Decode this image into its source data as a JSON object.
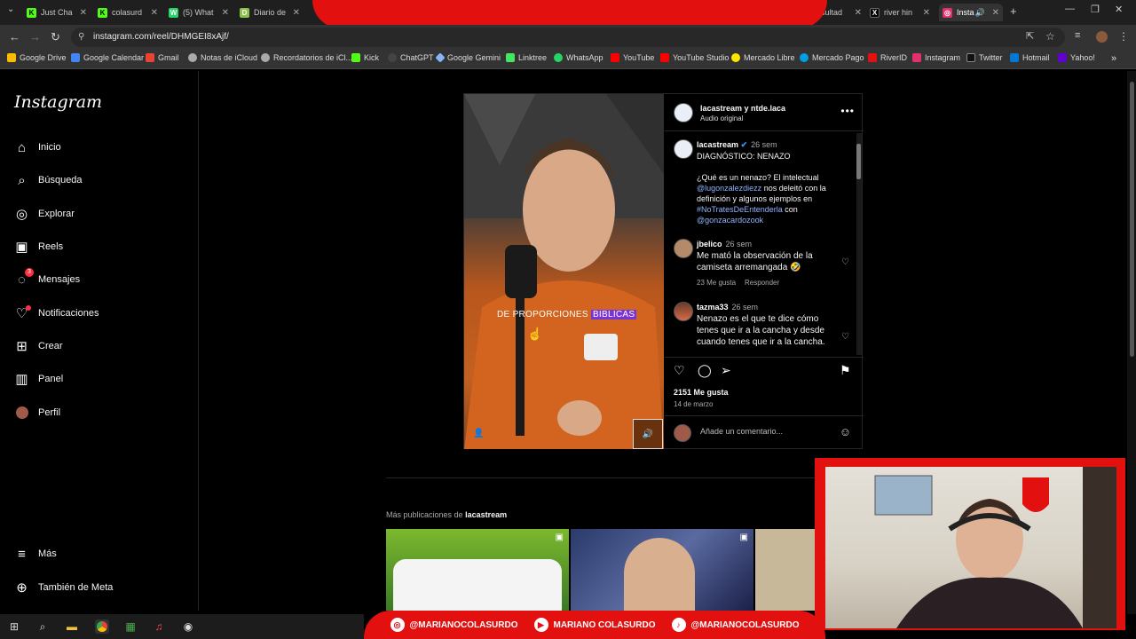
{
  "browser": {
    "tabs": [
      {
        "label": "Just Cha",
        "fav_color": "#53fc18",
        "fav_letter": "K"
      },
      {
        "label": "colasurd",
        "fav_color": "#53fc18",
        "fav_letter": "K"
      },
      {
        "label": "(5) What",
        "fav_color": "#25d366",
        "fav_letter": "W"
      },
      {
        "label": "Diario de",
        "fav_color": "#8bc34a",
        "fav_letter": "D"
      },
      {
        "label": "sultad",
        "fav_color": "#555555",
        "fav_letter": ""
      },
      {
        "label": "river hin",
        "fav_color": "#000000",
        "fav_letter": "X"
      },
      {
        "label": "Insta",
        "fav_color": "#e1306c",
        "fav_letter": "◎"
      }
    ],
    "url": "instagram.com/reel/DHMGEI8xAjf/",
    "bookmarks": [
      {
        "label": "Google Drive",
        "color": "#fbbc04"
      },
      {
        "label": "Google Calendar",
        "color": "#4285f4"
      },
      {
        "label": "Gmail",
        "color": "#ea4335"
      },
      {
        "label": "Notas de iCloud",
        "color": "#aaaaaa"
      },
      {
        "label": "Recordatorios de iCl...",
        "color": "#aaaaaa"
      },
      {
        "label": "Kick",
        "color": "#53fc18"
      },
      {
        "label": "ChatGPT",
        "color": "#444444"
      },
      {
        "label": "Google Gemini",
        "color": "#8ab4f8"
      },
      {
        "label": "Linktree",
        "color": "#43e660"
      },
      {
        "label": "WhatsApp",
        "color": "#25d366"
      },
      {
        "label": "YouTube",
        "color": "#ff0000"
      },
      {
        "label": "YouTube Studio",
        "color": "#ff0000"
      },
      {
        "label": "Mercado Libre",
        "color": "#ffe600"
      },
      {
        "label": "Mercado Pago",
        "color": "#009ee3"
      },
      {
        "label": "RiverID",
        "color": "#e31010"
      },
      {
        "label": "Instagram",
        "color": "#e1306c"
      },
      {
        "label": "Twitter",
        "color": "#111111"
      },
      {
        "label": "Hotmail",
        "color": "#0078d4"
      },
      {
        "label": "Yahoo!",
        "color": "#6001d2"
      }
    ]
  },
  "sidebar": {
    "logo": "Instagram",
    "items": [
      {
        "label": "Inicio",
        "icon": "⌂",
        "name": "home"
      },
      {
        "label": "Búsqueda",
        "icon": "⌕",
        "name": "search"
      },
      {
        "label": "Explorar",
        "icon": "◎",
        "name": "explore"
      },
      {
        "label": "Reels",
        "icon": "▣",
        "name": "reels"
      },
      {
        "label": "Mensajes",
        "icon": "◌",
        "name": "messages"
      },
      {
        "label": "Notificaciones",
        "icon": "♡",
        "name": "notifications"
      },
      {
        "label": "Crear",
        "icon": "⊞",
        "name": "create"
      },
      {
        "label": "Panel",
        "icon": "▥",
        "name": "dashboard"
      },
      {
        "label": "Perfil",
        "icon": "●",
        "name": "profile"
      }
    ],
    "messages_badge": "3",
    "more": {
      "label": "Más",
      "icon": "≡"
    },
    "meta": {
      "label": "También de Meta",
      "icon": "⊕"
    }
  },
  "post": {
    "header_name": "lacastream y ntde.laca",
    "header_audio": "Audio original",
    "caption_overlay_a": "DE PROPORCIONES ",
    "caption_overlay_b": "BIBLICAS",
    "caption": {
      "user": "lacastream",
      "time": "26 sem",
      "title": "DIAGNÓSTICO: NENAZO",
      "line1": "¿Qué es un nenazo? El intelectual",
      "mention1": "@lugonzalezdiezz",
      "line2": " nos deleitó con la definición y algunos ejemplos en",
      "hashtag": "#NoTratesDeEntenderla",
      "line3": " con",
      "mention2": "@gonzacardozook"
    },
    "comments": [
      {
        "user": "jbelico",
        "time": "26 sem",
        "text": "Me mató la observación de la camiseta arremangada 🤣",
        "likes": "23 Me gusta",
        "reply": "Responder"
      },
      {
        "user": "tazma33",
        "time": "26 sem",
        "text": "Nenazo es el que te dice cómo tenes que ir a la cancha y desde cuando tenes que ir a la cancha."
      }
    ],
    "likes": "2151 Me gusta",
    "date": "14 de marzo",
    "comment_placeholder": "Añade un comentario..."
  },
  "more_posts": {
    "prefix": "Más publicaciones de ",
    "user": "lacastream"
  },
  "overlay": {
    "social": [
      {
        "label": "@MARIANOCOLASURDO",
        "icon": "◎"
      },
      {
        "label": "MARIANO COLASURDO",
        "icon": "▶"
      },
      {
        "label": "@MARIANOCOLASURDO",
        "icon": "♪"
      }
    ]
  },
  "colors": {
    "accent_red": "#e31010",
    "mention_blue": "#8fb4ff",
    "highlight_purple": "#7b34d4"
  }
}
